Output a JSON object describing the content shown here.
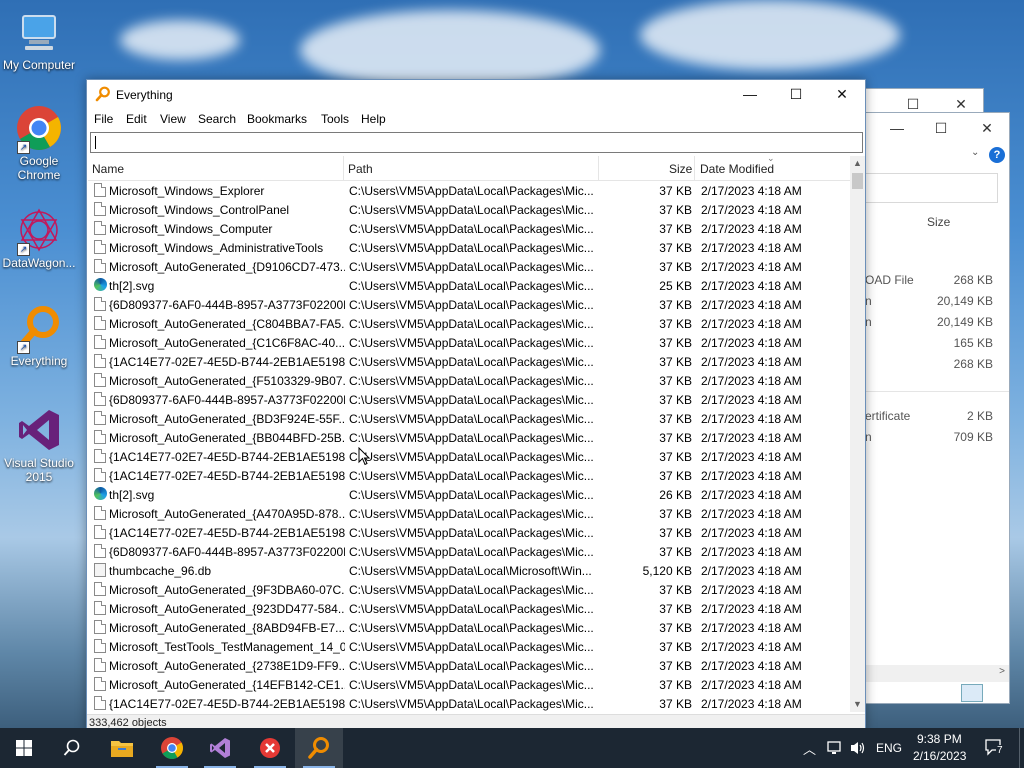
{
  "desktop": {
    "icons": [
      {
        "label": "My Computer",
        "icon": "computer-icon"
      },
      {
        "label": "Google Chrome",
        "icon": "chrome-icon"
      },
      {
        "label": "DataWagon...",
        "icon": "datawagon-icon"
      },
      {
        "label": "Everything",
        "icon": "everything-icon"
      },
      {
        "label": "Visual Studio 2015",
        "icon": "visual-studio-icon"
      }
    ]
  },
  "bg_explorer": {
    "column_size": "Size",
    "rows": [
      {
        "type": "OAD File",
        "size": "268 KB"
      },
      {
        "type": "n",
        "size": "20,149 KB"
      },
      {
        "type": "n",
        "size": "20,149 KB"
      },
      {
        "type": "",
        "size": "165 KB"
      },
      {
        "type": "",
        "size": "268 KB"
      },
      {
        "type": "ertificate",
        "size": "2 KB"
      },
      {
        "type": "n",
        "size": "709 KB"
      }
    ]
  },
  "window": {
    "title": "Everything",
    "menu": [
      "File",
      "Edit",
      "View",
      "Search",
      "Bookmarks",
      "Tools",
      "Help"
    ],
    "search": {
      "value": ""
    },
    "columns": {
      "name": "Name",
      "path": "Path",
      "size": "Size",
      "date": "Date Modified"
    },
    "rows": [
      {
        "icon": "doc",
        "name": "Microsoft_Windows_Explorer",
        "path": "C:\\Users\\VM5\\AppData\\Local\\Packages\\Mic...",
        "size": "37 KB",
        "date": "2/17/2023 4:18 AM"
      },
      {
        "icon": "doc",
        "name": "Microsoft_Windows_ControlPanel",
        "path": "C:\\Users\\VM5\\AppData\\Local\\Packages\\Mic...",
        "size": "37 KB",
        "date": "2/17/2023 4:18 AM"
      },
      {
        "icon": "doc",
        "name": "Microsoft_Windows_Computer",
        "path": "C:\\Users\\VM5\\AppData\\Local\\Packages\\Mic...",
        "size": "37 KB",
        "date": "2/17/2023 4:18 AM"
      },
      {
        "icon": "doc",
        "name": "Microsoft_Windows_AdministrativeTools",
        "path": "C:\\Users\\VM5\\AppData\\Local\\Packages\\Mic...",
        "size": "37 KB",
        "date": "2/17/2023 4:18 AM"
      },
      {
        "icon": "doc",
        "name": "Microsoft_AutoGenerated_{D9106CD7-473...",
        "path": "C:\\Users\\VM5\\AppData\\Local\\Packages\\Mic...",
        "size": "37 KB",
        "date": "2/17/2023 4:18 AM"
      },
      {
        "icon": "edge",
        "name": "th[2].svg",
        "path": "C:\\Users\\VM5\\AppData\\Local\\Packages\\Mic...",
        "size": "25 KB",
        "date": "2/17/2023 4:18 AM"
      },
      {
        "icon": "doc",
        "name": "{6D809377-6AF0-444B-8957-A3773F02200E...",
        "path": "C:\\Users\\VM5\\AppData\\Local\\Packages\\Mic...",
        "size": "37 KB",
        "date": "2/17/2023 4:18 AM"
      },
      {
        "icon": "doc",
        "name": "Microsoft_AutoGenerated_{C804BBA7-FA5...",
        "path": "C:\\Users\\VM5\\AppData\\Local\\Packages\\Mic...",
        "size": "37 KB",
        "date": "2/17/2023 4:18 AM"
      },
      {
        "icon": "doc",
        "name": "Microsoft_AutoGenerated_{C1C6F8AC-40...",
        "path": "C:\\Users\\VM5\\AppData\\Local\\Packages\\Mic...",
        "size": "37 KB",
        "date": "2/17/2023 4:18 AM"
      },
      {
        "icon": "doc",
        "name": "{1AC14E77-02E7-4E5D-B744-2EB1AE5198B...",
        "path": "C:\\Users\\VM5\\AppData\\Local\\Packages\\Mic...",
        "size": "37 KB",
        "date": "2/17/2023 4:18 AM"
      },
      {
        "icon": "doc",
        "name": "Microsoft_AutoGenerated_{F5103329-9B07...",
        "path": "C:\\Users\\VM5\\AppData\\Local\\Packages\\Mic...",
        "size": "37 KB",
        "date": "2/17/2023 4:18 AM"
      },
      {
        "icon": "doc",
        "name": "{6D809377-6AF0-444B-8957-A3773F02200E...",
        "path": "C:\\Users\\VM5\\AppData\\Local\\Packages\\Mic...",
        "size": "37 KB",
        "date": "2/17/2023 4:18 AM"
      },
      {
        "icon": "doc",
        "name": "Microsoft_AutoGenerated_{BD3F924E-55F...",
        "path": "C:\\Users\\VM5\\AppData\\Local\\Packages\\Mic...",
        "size": "37 KB",
        "date": "2/17/2023 4:18 AM"
      },
      {
        "icon": "doc",
        "name": "Microsoft_AutoGenerated_{BB044BFD-25B...",
        "path": "C:\\Users\\VM5\\AppData\\Local\\Packages\\Mic...",
        "size": "37 KB",
        "date": "2/17/2023 4:18 AM"
      },
      {
        "icon": "doc",
        "name": "{1AC14E77-02E7-4E5D-B744-2EB1AE5198B...",
        "path": "C:\\Users\\VM5\\AppData\\Local\\Packages\\Mic...",
        "size": "37 KB",
        "date": "2/17/2023 4:18 AM"
      },
      {
        "icon": "doc",
        "name": "{1AC14E77-02E7-4E5D-B744-2EB1AE5198B...",
        "path": "C:\\Users\\VM5\\AppData\\Local\\Packages\\Mic...",
        "size": "37 KB",
        "date": "2/17/2023 4:18 AM"
      },
      {
        "icon": "edge",
        "name": "th[2].svg",
        "path": "C:\\Users\\VM5\\AppData\\Local\\Packages\\Mic...",
        "size": "26 KB",
        "date": "2/17/2023 4:18 AM"
      },
      {
        "icon": "doc",
        "name": "Microsoft_AutoGenerated_{A470A95D-878...",
        "path": "C:\\Users\\VM5\\AppData\\Local\\Packages\\Mic...",
        "size": "37 KB",
        "date": "2/17/2023 4:18 AM"
      },
      {
        "icon": "doc",
        "name": "{1AC14E77-02E7-4E5D-B744-2EB1AE5198B...",
        "path": "C:\\Users\\VM5\\AppData\\Local\\Packages\\Mic...",
        "size": "37 KB",
        "date": "2/17/2023 4:18 AM"
      },
      {
        "icon": "doc",
        "name": "{6D809377-6AF0-444B-8957-A3773F02200E...",
        "path": "C:\\Users\\VM5\\AppData\\Local\\Packages\\Mic...",
        "size": "37 KB",
        "date": "2/17/2023 4:18 AM"
      },
      {
        "icon": "db",
        "name": "thumbcache_96.db",
        "path": "C:\\Users\\VM5\\AppData\\Local\\Microsoft\\Win...",
        "size": "5,120 KB",
        "date": "2/17/2023 4:18 AM"
      },
      {
        "icon": "doc",
        "name": "Microsoft_AutoGenerated_{9F3DBA60-07C...",
        "path": "C:\\Users\\VM5\\AppData\\Local\\Packages\\Mic...",
        "size": "37 KB",
        "date": "2/17/2023 4:18 AM"
      },
      {
        "icon": "doc",
        "name": "Microsoft_AutoGenerated_{923DD477-584...",
        "path": "C:\\Users\\VM5\\AppData\\Local\\Packages\\Mic...",
        "size": "37 KB",
        "date": "2/17/2023 4:18 AM"
      },
      {
        "icon": "doc",
        "name": "Microsoft_AutoGenerated_{8ABD94FB-E7...",
        "path": "C:\\Users\\VM5\\AppData\\Local\\Packages\\Mic...",
        "size": "37 KB",
        "date": "2/17/2023 4:18 AM"
      },
      {
        "icon": "doc",
        "name": "Microsoft_TestTools_TestManagement_14_0",
        "path": "C:\\Users\\VM5\\AppData\\Local\\Packages\\Mic...",
        "size": "37 KB",
        "date": "2/17/2023 4:18 AM"
      },
      {
        "icon": "doc",
        "name": "Microsoft_AutoGenerated_{2738E1D9-FF9...",
        "path": "C:\\Users\\VM5\\AppData\\Local\\Packages\\Mic...",
        "size": "37 KB",
        "date": "2/17/2023 4:18 AM"
      },
      {
        "icon": "doc",
        "name": "Microsoft_AutoGenerated_{14EFB142-CE1...",
        "path": "C:\\Users\\VM5\\AppData\\Local\\Packages\\Mic...",
        "size": "37 KB",
        "date": "2/17/2023 4:18 AM"
      },
      {
        "icon": "doc",
        "name": "{1AC14E77-02E7-4E5D-B744-2EB1AE5198B...",
        "path": "C:\\Users\\VM5\\AppData\\Local\\Packages\\Mic...",
        "size": "37 KB",
        "date": "2/17/2023 4:18 AM"
      }
    ],
    "status": "333,462 objects"
  },
  "taskbar": {
    "language": "ENG",
    "time": "9:38 PM",
    "date": "2/16/2023",
    "notification_count": "7"
  },
  "colors": {
    "taskbar": "#1c2733",
    "accent": "#f08c00"
  }
}
